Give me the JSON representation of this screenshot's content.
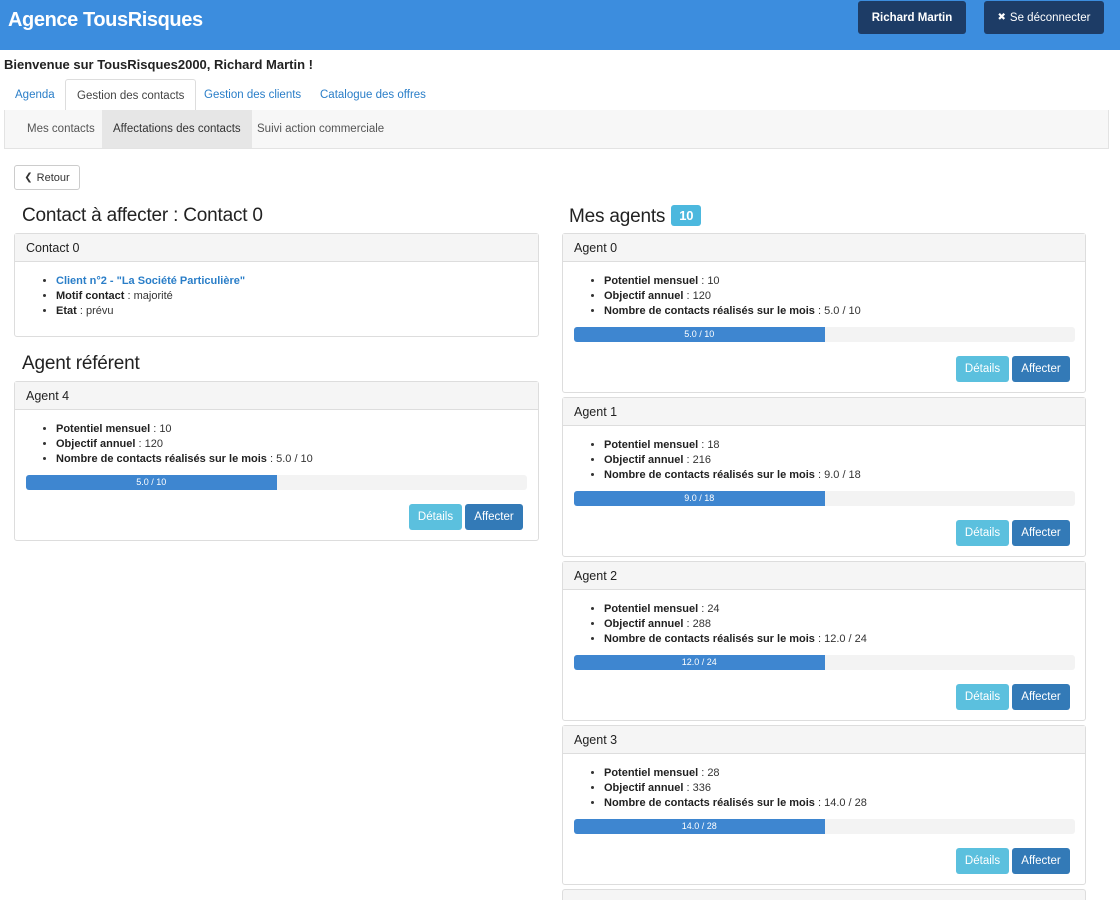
{
  "header": {
    "brand": "Agence TousRisques",
    "user_button": "Richard Martin",
    "logout_icon": "✖",
    "logout_label": "Se déconnecter"
  },
  "welcome": "Bienvenue sur TousRisques2000, Richard Martin !",
  "tabs": [
    {
      "label": "Agenda",
      "active": false
    },
    {
      "label": "Gestion des contacts",
      "active": true
    },
    {
      "label": "Gestion des clients",
      "active": false
    },
    {
      "label": "Catalogue des offres",
      "active": false
    }
  ],
  "subtabs": [
    {
      "label": "Mes contacts",
      "active": false
    },
    {
      "label": "Affectations des contacts",
      "active": true
    },
    {
      "label": "Suivi action commerciale",
      "active": false
    }
  ],
  "back_button": {
    "icon": "❮",
    "label": "Retour"
  },
  "contact_section": {
    "title": "Contact à affecter : Contact 0",
    "panel_title": "Contact 0",
    "client_link": "Client n°2 - \"La Société Particulière\"",
    "motif_label": "Motif contact",
    "motif_value": "majorité",
    "etat_label": "Etat",
    "etat_value": "prévu"
  },
  "referent_section": {
    "title": "Agent référent",
    "agent": {
      "name": "Agent 4",
      "potentiel": "10",
      "objectif": "120",
      "realises": "5.0 / 10",
      "progress_label": "5.0 / 10",
      "progress_fraction": 0.5
    }
  },
  "labels": {
    "potentiel": "Potentiel mensuel",
    "objectif": "Objectif annuel",
    "realises": "Nombre de contacts réalisés sur le mois",
    "separator": " : ",
    "details": "Détails",
    "assign": "Affecter"
  },
  "agents_section": {
    "title": "Mes agents",
    "count": "10",
    "agents": [
      {
        "name": "Agent 0",
        "potentiel": "10",
        "objectif": "120",
        "realises": "5.0 / 10",
        "progress_label": "5.0 / 10",
        "progress_fraction": 0.5
      },
      {
        "name": "Agent 1",
        "potentiel": "18",
        "objectif": "216",
        "realises": "9.0 / 18",
        "progress_label": "9.0 / 18",
        "progress_fraction": 0.5
      },
      {
        "name": "Agent 2",
        "potentiel": "24",
        "objectif": "288",
        "realises": "12.0 / 24",
        "progress_label": "12.0 / 24",
        "progress_fraction": 0.5
      },
      {
        "name": "Agent 3",
        "potentiel": "28",
        "objectif": "336",
        "realises": "14.0 / 28",
        "progress_label": "14.0 / 28",
        "progress_fraction": 0.5
      }
    ]
  },
  "colors": {
    "topbar": "#3c8dde",
    "dark_button": "#1d3c66",
    "progress": "#3e86d0",
    "details_button": "#5bc0de",
    "assign_button": "#337ab7",
    "badge": "#4cb8de"
  }
}
